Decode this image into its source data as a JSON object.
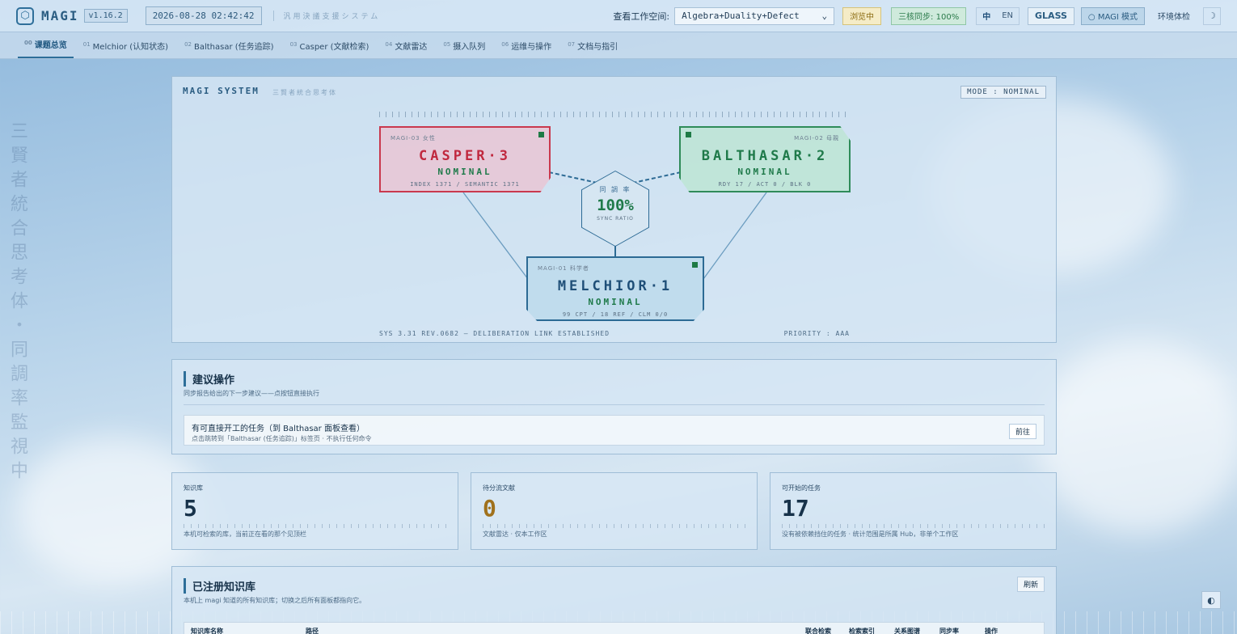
{
  "header": {
    "brand": "MAGI",
    "version": "v1.16.2",
    "datetime": "2026-08-28 02:42:42",
    "system_name": "汎用決議支援システム",
    "workspace_label": "查看工作空间:",
    "workspace_value": "Algebra+Duality+Defect",
    "browse_chip": "浏览中",
    "sync_chip": "三核同步: 100%",
    "lang_zh": "中",
    "lang_en": "EN",
    "glass_label": "GLASS",
    "magi_mode_label": "○ MAGI 模式",
    "env_check_label": "环境体检",
    "theme_toggle_icon": "☽"
  },
  "tabs": [
    {
      "num": "00",
      "label": "课题总览",
      "active": true
    },
    {
      "num": "01",
      "label": "Melchior (认知状态)"
    },
    {
      "num": "02",
      "label": "Balthasar (任务追踪)"
    },
    {
      "num": "03",
      "label": "Casper (文献检索)"
    },
    {
      "num": "04",
      "label": "文献雷达"
    },
    {
      "num": "05",
      "label": "摄入队列"
    },
    {
      "num": "06",
      "label": "运维与操作"
    },
    {
      "num": "07",
      "label": "文档与指引"
    }
  ],
  "side_text": "三賢者統合思考体・同調率監視中",
  "hero": {
    "title": "MAGI SYSTEM",
    "subtitle": "三賢者統合思考体",
    "mode": "MODE : NOMINAL",
    "casper": {
      "tag": "MAGI-03 女性",
      "name": "CASPER·3",
      "state": "NOMINAL",
      "meta": "INDEX 1371 / SEMANTIC 1371"
    },
    "balthasar": {
      "tag": "MAGI-02 母親",
      "name": "BALTHASAR·2",
      "state": "NOMINAL",
      "meta": "RDY 17 / ACT 0 / BLK 0"
    },
    "melchior": {
      "tag": "MAGI-01 科学者",
      "name": "MELCHIOR·1",
      "state": "NOMINAL",
      "meta": "99 CPT / 18 REF / CLM 0/0"
    },
    "sync_label": "同 調 率",
    "sync_value": "100%",
    "sync_sub": "SYNC RATIO",
    "footer_left": "SYS 3.31 REV.0682 — DELIBERATION LINK ESTABLISHED",
    "footer_right": "PRIORITY : AAA"
  },
  "suggest": {
    "title": "建议操作",
    "subtitle": "同步报告给出的下一步建议——点按钮直接执行",
    "item_title": "有可直接开工的任务（到 Balthasar 面板查看）",
    "item_sub": "点击跳转到「Balthasar (任务追踪)」标签页 · 不执行任何命令",
    "go_label": "前往"
  },
  "stats": [
    {
      "caption": "知识库",
      "value": "5",
      "desc": "本机可检索的库，当前正在看的那个见顶栏"
    },
    {
      "caption": "待分流文献",
      "value": "0",
      "desc": "文献雷达 · 仅本工作区"
    },
    {
      "caption": "可开始的任务",
      "value": "17",
      "desc": "没有被依赖挡住的任务 · 统计范围是所属 Hub，非单个工作区"
    }
  ],
  "kb": {
    "title": "已注册知识库",
    "subtitle": "本机上 magi 知道的所有知识库；切换之后所有面板都指向它。",
    "refresh_label": "刷新",
    "columns": [
      "知识库名称",
      "路径",
      "联合检索",
      "检索索引",
      "关系图谱",
      "同步率",
      "操作"
    ]
  },
  "float_button_icon": "◐",
  "colors": {
    "casper": "#c0283e",
    "balthasar": "#1f7a4a",
    "melchior": "#1f4f78",
    "accent": "#2d6e99"
  }
}
